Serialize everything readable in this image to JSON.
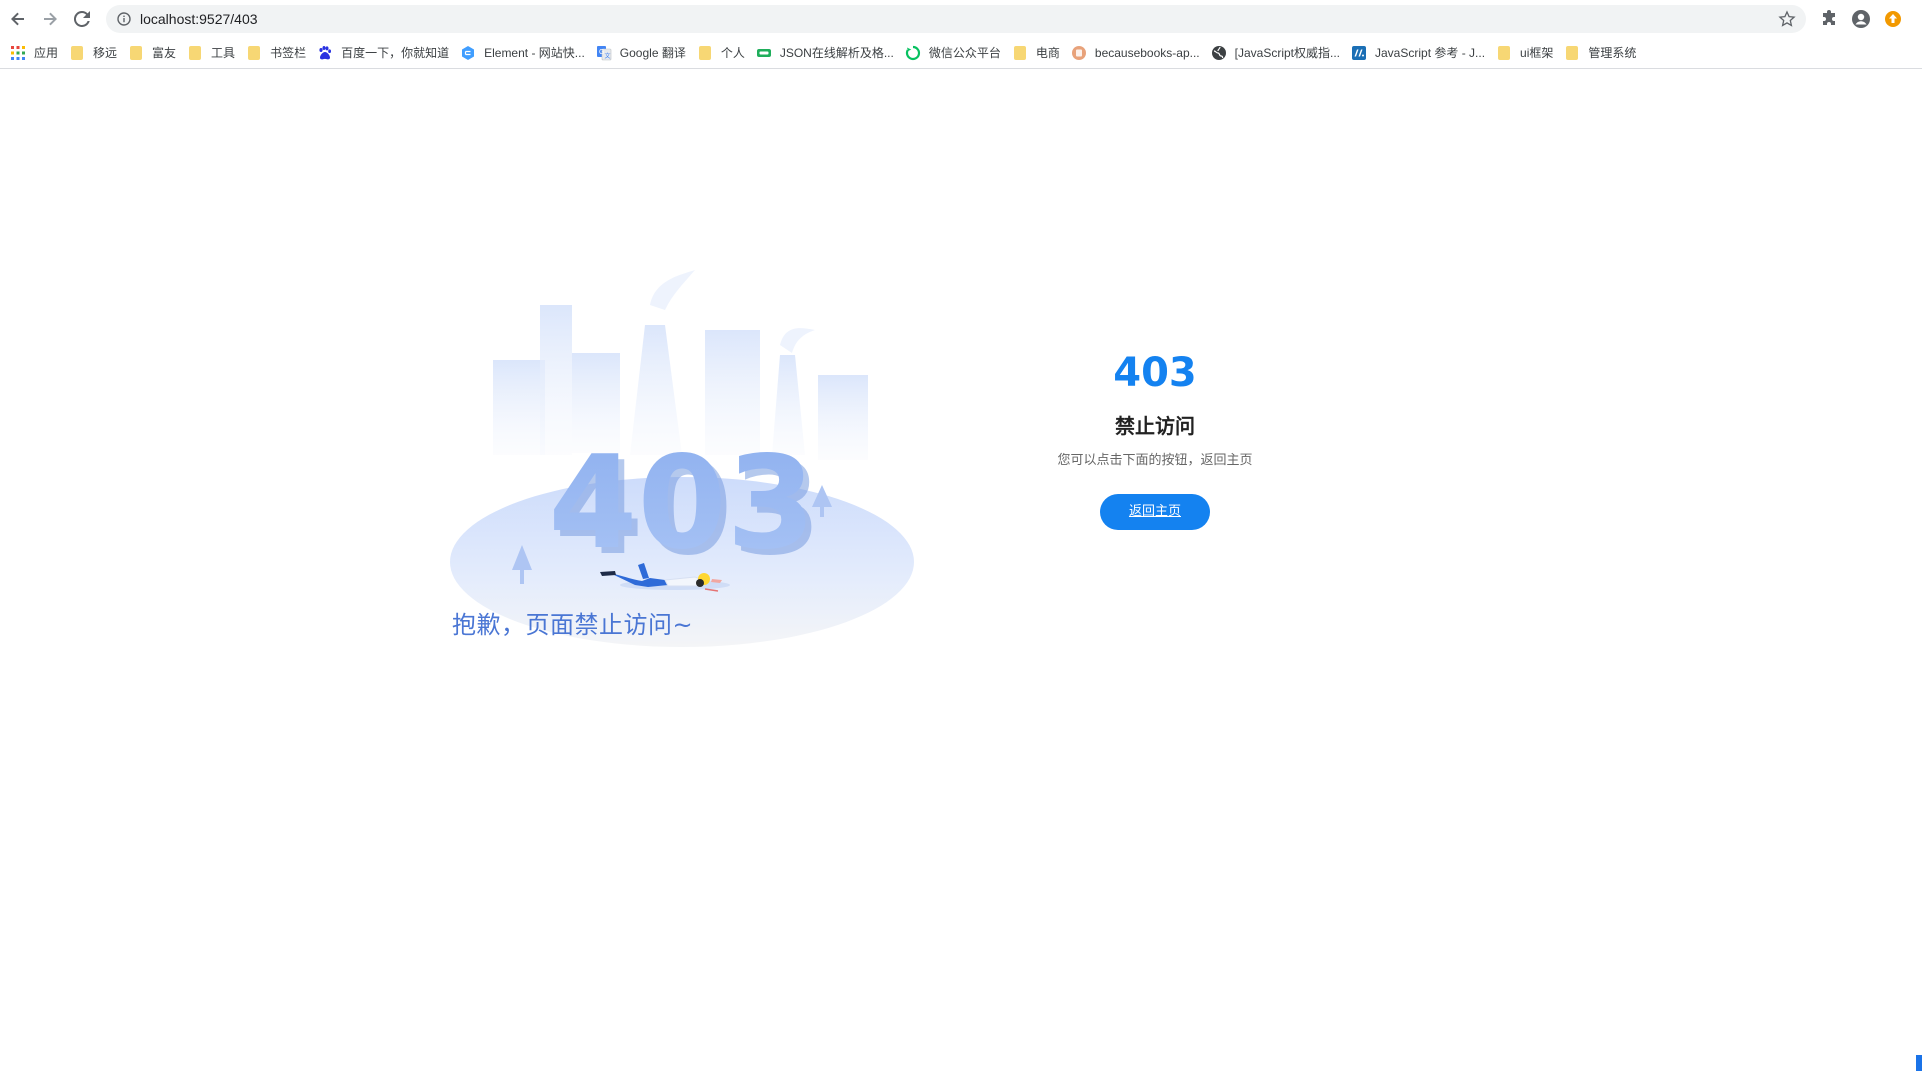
{
  "browser": {
    "url": "localhost:9527/403",
    "icons": [
      "back-arrow-icon",
      "forward-arrow-icon",
      "reload-icon",
      "info-icon",
      "star-icon",
      "extensions-icon",
      "profile-icon",
      "update-icon"
    ],
    "accent": "#1a73e8"
  },
  "bookmarks": [
    {
      "label": "应用",
      "icon": "apps-grid-icon"
    },
    {
      "label": "移远",
      "icon": "folder-icon"
    },
    {
      "label": "富友",
      "icon": "folder-icon"
    },
    {
      "label": "工具",
      "icon": "folder-icon"
    },
    {
      "label": "书签栏",
      "icon": "folder-icon"
    },
    {
      "label": "百度一下，你就知道",
      "icon": "baidu-paw-icon"
    },
    {
      "label": "Element - 网站快...",
      "icon": "element-icon"
    },
    {
      "label": "Google 翻译",
      "icon": "google-translate-icon"
    },
    {
      "label": "个人",
      "icon": "folder-icon"
    },
    {
      "label": "JSON在线解析及格...",
      "icon": "json-icon"
    },
    {
      "label": "微信公众平台",
      "icon": "wechat-icon"
    },
    {
      "label": "电商",
      "icon": "folder-icon"
    },
    {
      "label": "becausebooks-ap...",
      "icon": "becausebooks-icon"
    },
    {
      "label": "[JavaScript权威指...",
      "icon": "globe-icon"
    },
    {
      "label": "JavaScript 参考 - J...",
      "icon": "mdn-icon"
    },
    {
      "label": "ui框架",
      "icon": "folder-icon"
    },
    {
      "label": "管理系统",
      "icon": "folder-icon"
    }
  ],
  "page": {
    "illustration_number": "403",
    "sorry_text": "抱歉，页面禁止访问~",
    "code": "403",
    "headline": "禁止访问",
    "subline": "您可以点击下面的按钮，返回主页",
    "home_button": "返回主页",
    "colors": {
      "primary": "#1482f0",
      "sorry": "#4a76d4"
    }
  }
}
